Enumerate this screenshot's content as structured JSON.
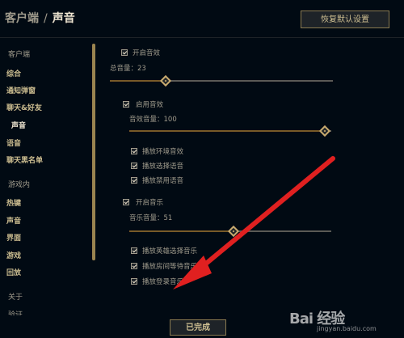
{
  "header": {
    "breadcrumb_root": "客户端",
    "separator": "/",
    "title": "声音",
    "reset_button": "恢复默认设置"
  },
  "sidebar": {
    "client_header": "客户端",
    "client_items": [
      "综合",
      "通知弹窗",
      "聊天&好友",
      "声音",
      "语音",
      "聊天黑名单"
    ],
    "active_item": "声音",
    "ingame_header": "游戏内",
    "ingame_items": [
      "热键",
      "声音",
      "界面",
      "游戏",
      "回放"
    ],
    "about_header": "关于",
    "about_items": [
      "验证"
    ]
  },
  "sound": {
    "enable_sound": {
      "label": "开启音效",
      "checked": true
    },
    "master_volume": {
      "label": "总音量：23",
      "value": 23
    },
    "enable_sfx": {
      "label": "启用音效",
      "checked": true
    },
    "sfx_volume": {
      "label": "音效音量：100",
      "value": 100
    },
    "sfx_options": [
      {
        "label": "播放环境音效",
        "checked": true
      },
      {
        "label": "播放选择语音",
        "checked": true
      },
      {
        "label": "播放禁用语音",
        "checked": true
      }
    ],
    "enable_music": {
      "label": "开启音乐",
      "checked": true
    },
    "music_volume": {
      "label": "音乐音量：51",
      "value": 51
    },
    "music_options": [
      {
        "label": "播放英雄选择音乐",
        "checked": true
      },
      {
        "label": "播放房间等待音乐",
        "checked": true
      },
      {
        "label": "播放登录音乐",
        "checked": true
      }
    ]
  },
  "footer": {
    "done_button": "已完成"
  },
  "watermark": {
    "logo": "Bai 经验",
    "url": "jingyan.baidu.com"
  },
  "colors": {
    "gold": "#c8aa6e",
    "background": "#010a13",
    "arrow": "#e02020"
  }
}
